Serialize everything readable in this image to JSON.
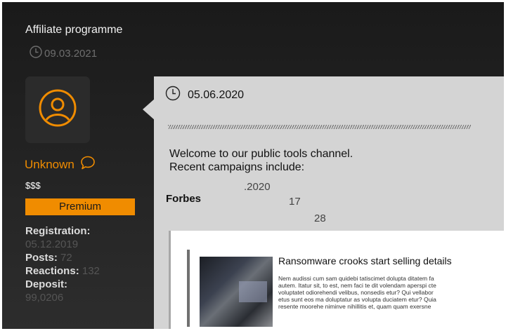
{
  "thread": {
    "title": "Affiliate programme",
    "date": "09.03.2021"
  },
  "user": {
    "name": "Unknown",
    "rank": "$$$",
    "badge": "Premium",
    "stats": [
      {
        "label": "Registration:",
        "value": "05.12.2019"
      },
      {
        "label": "Posts:",
        "value": "72"
      },
      {
        "label": "Reactions:",
        "value": "132"
      },
      {
        "label": "Deposit:",
        "value": "99,0206"
      }
    ]
  },
  "post": {
    "date": "05.06.2020",
    "text_line1": "Welcome to our public tools channel.",
    "text_line2": "Recent campaigns include:",
    "fragments": {
      "forbes": "Forbes",
      "year": ".2020",
      "n17": "17",
      "n28": "28"
    },
    "embed": {
      "title": "Ransomware crooks start selling details",
      "body_lines": [
        "Nem audissi cum sam quidebi tatiscimet dolupta ditatem fa",
        "autem. Itatur sit, to est, nem faci te dit volendam aperspi cte",
        "voluptatet odiorehendi velibus, nonsedis etur? Qui vellabor",
        "etus sunt eos ma doluptatur as volupta duciatem etur? Quia",
        "resente moorehe niminve nihillitis et, quam quam exersne"
      ]
    }
  },
  "colors": {
    "accent": "#f08c00",
    "panel_bg": "#1f1f1f",
    "post_bg": "#d4d4d4"
  },
  "icons": {
    "clock": "clock-icon",
    "avatar": "user-avatar-icon",
    "message": "message-bubble-icon"
  }
}
